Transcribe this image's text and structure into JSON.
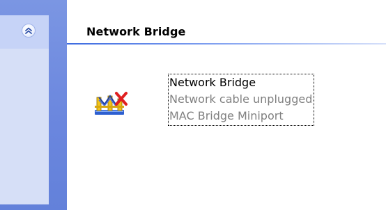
{
  "section": {
    "title": "Network Bridge"
  },
  "connection": {
    "name": "Network Bridge",
    "status": "Network cable unplugged",
    "device": "MAC Bridge Miniport",
    "icon": "network-bridge-disconnected-icon"
  },
  "sidebar": {
    "collapse_icon": "chevron-up-double-icon"
  },
  "colors": {
    "sidebar_blue": "#7b96e3",
    "panel_light": "#d6dff7",
    "rule_blue": "#3d6be0",
    "status_gray": "#808080",
    "error_red": "#e02020"
  }
}
